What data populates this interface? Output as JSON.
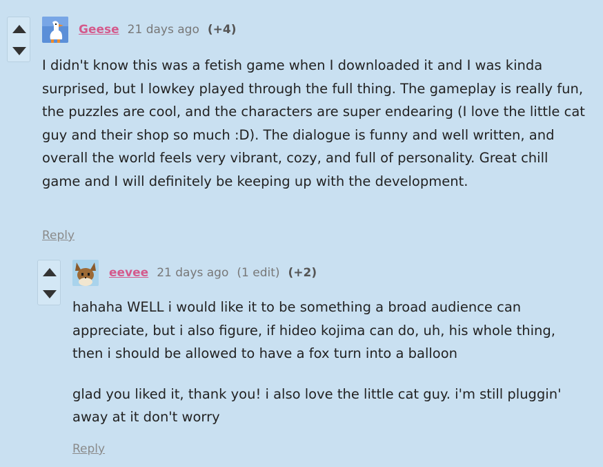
{
  "comments": [
    {
      "username": "Geese",
      "time": "21 days ago",
      "score": "(+4)",
      "avatar": "goose-avatar",
      "body": [
        "I didn't know this was a fetish game when I downloaded it and I was kinda surprised, but I lowkey played through the full thing. The gameplay is really fun, the puzzles are cool, and the characters are super endearing (I love the little cat guy and their shop so much :D). The dialogue is funny and well written, and overall the world feels very vibrant, cozy, and full of personality. Great chill game and I will definitely be keeping up with the development."
      ],
      "reply": "Reply"
    },
    {
      "username": "eevee",
      "time": "21 days ago",
      "edit": "(1 edit)",
      "score": "(+2)",
      "avatar": "fox-avatar",
      "body": [
        "hahaha WELL i would like it to be something a broad audience can appreciate, but i also figure, if hideo kojima can do, uh, his whole thing, then i should be allowed to have a fox turn into a balloon",
        "glad you liked it, thank you!  i also love the little cat guy.  i'm still pluggin' away at it don't worry"
      ],
      "reply": "Reply"
    }
  ],
  "icons": {
    "upvote": "triangle-up-icon",
    "downvote": "triangle-down-icon"
  },
  "colors": {
    "background": "#c9e0f1",
    "username": "#d45a8c",
    "muted": "#777777",
    "text": "#222222"
  }
}
